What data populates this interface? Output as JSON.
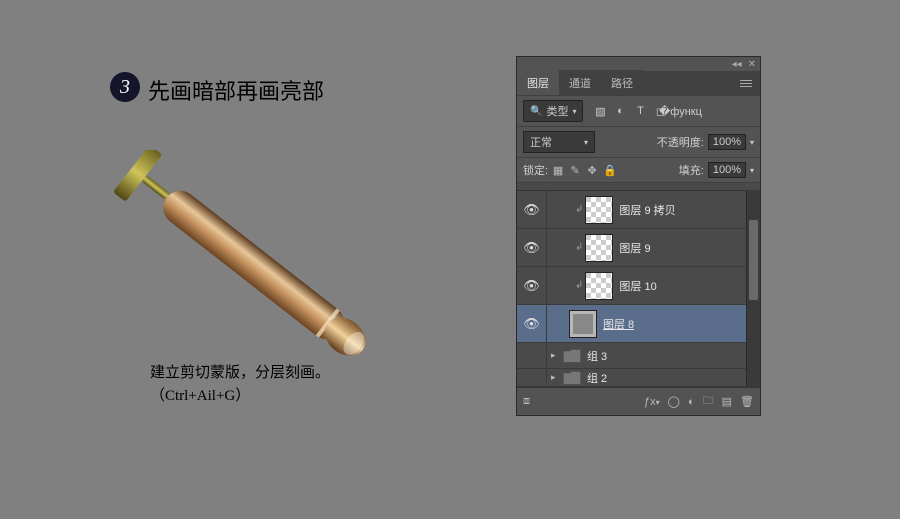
{
  "step": {
    "number": "3",
    "title": "先画暗部再画亮部"
  },
  "caption": {
    "line1": "建立剪切蒙版，分层刻画。",
    "line2": "（Ctrl+Ail+G）"
  },
  "panel": {
    "tabs": {
      "layers": "图层",
      "channels": "通道",
      "paths": "路径"
    },
    "filter_label": "类型",
    "blend_mode": "正常",
    "opacity_label": "不透明度:",
    "opacity_value": "100%",
    "lock_label": "锁定:",
    "fill_label": "填充:",
    "fill_value": "100%",
    "type_icons": {
      "image": "image-icon",
      "adjust": "adjust-icon",
      "type": "type-icon",
      "shape": "shape-icon",
      "smart": "smart-icon"
    },
    "layers": [
      {
        "name": "图层 9 拷贝",
        "visible": true,
        "clipped": true,
        "thumb": "checker"
      },
      {
        "name": "图层 9",
        "visible": true,
        "clipped": true,
        "thumb": "checker"
      },
      {
        "name": "图层 10",
        "visible": true,
        "clipped": true,
        "thumb": "checker"
      },
      {
        "name": "图层 8",
        "visible": true,
        "clipped": false,
        "thumb": "solid",
        "selected": true
      },
      {
        "name": "组 3",
        "visible": true,
        "group": true
      },
      {
        "name": "组 2",
        "visible": false,
        "group": true,
        "partial": true
      }
    ],
    "footer_icons": {
      "link": "link-icon",
      "fx": "fx-icon",
      "mask": "mask-icon",
      "adjust": "fill-adjust-icon",
      "group": "new-group-icon",
      "new": "new-layer-icon",
      "trash": "trash-icon"
    }
  }
}
